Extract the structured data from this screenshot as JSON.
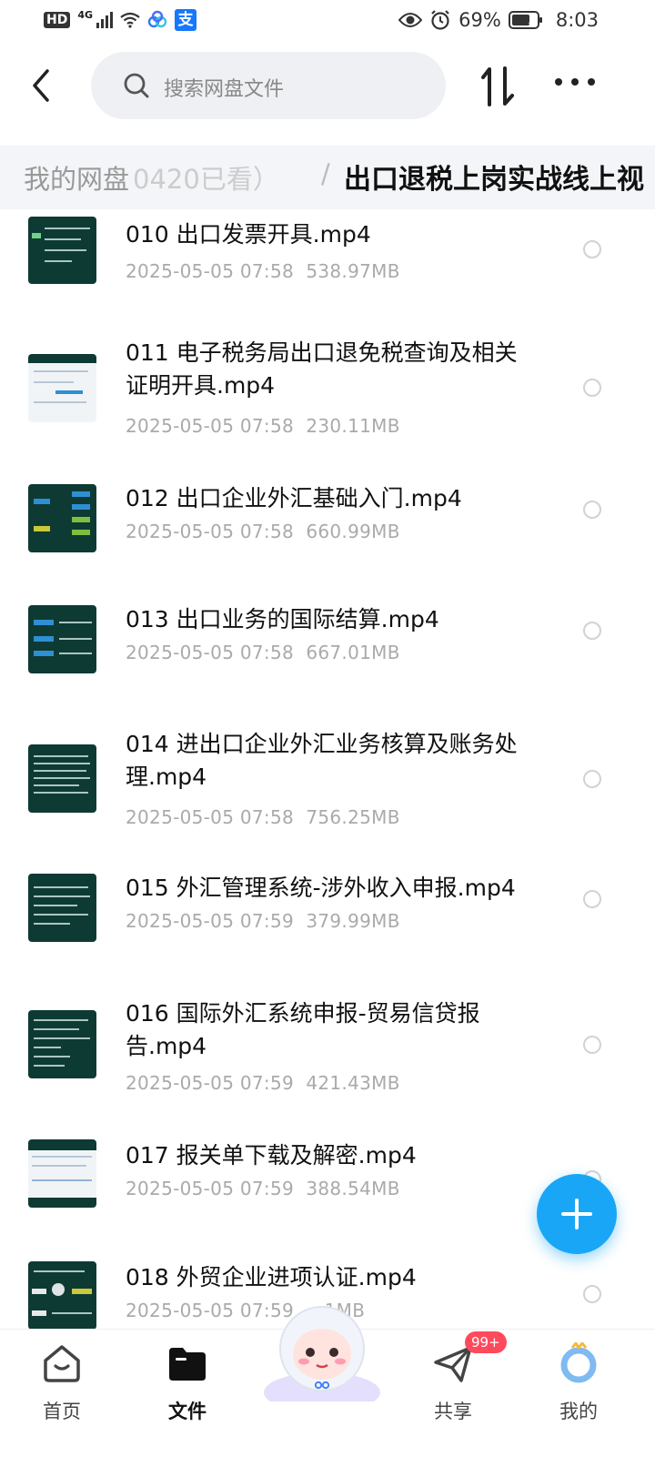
{
  "status_bar": {
    "hd": "HD",
    "network": "4G",
    "battery": "69%",
    "time": "8:03"
  },
  "search": {
    "placeholder": "搜索网盘文件"
  },
  "breadcrumb": {
    "root": "我的网盘",
    "root_partial": "0420已看）",
    "separator": "/",
    "current": "出口退税上岗实战线上视"
  },
  "files": [
    {
      "name": "010 出口发票开具.mp4",
      "date": "2025-05-05  07:58",
      "size": "538.97MB"
    },
    {
      "name": "011 电子税务局出口退免税查询及相关证明开具.mp4",
      "date": "2025-05-05  07:58",
      "size": "230.11MB"
    },
    {
      "name": "012 出口企业外汇基础入门.mp4",
      "date": "2025-05-05  07:58",
      "size": "660.99MB"
    },
    {
      "name": "013 出口业务的国际结算.mp4",
      "date": "2025-05-05  07:58",
      "size": "667.01MB"
    },
    {
      "name": "014 进出口企业外汇业务核算及账务处理.mp4",
      "date": "2025-05-05  07:58",
      "size": "756.25MB"
    },
    {
      "name": "015 外汇管理系统-涉外收入申报.mp4",
      "date": "2025-05-05  07:59",
      "size": "379.99MB"
    },
    {
      "name": "016 国际外汇系统申报-贸易信贷报告.mp4",
      "date": "2025-05-05  07:59",
      "size": "421.43MB"
    },
    {
      "name": "017 报关单下载及解密.mp4",
      "date": "2025-05-05  07:59",
      "size": "388.54MB"
    },
    {
      "name": "018 外贸企业进项认证.mp4",
      "date": "2025-05-05  07:59",
      "size": "…1MB"
    }
  ],
  "nav": {
    "home": "首页",
    "files": "文件",
    "share": "共享",
    "share_badge": "99+",
    "mine": "我的"
  },
  "colors": {
    "accent": "#1aa6f6",
    "badge": "#ff4a5c"
  }
}
